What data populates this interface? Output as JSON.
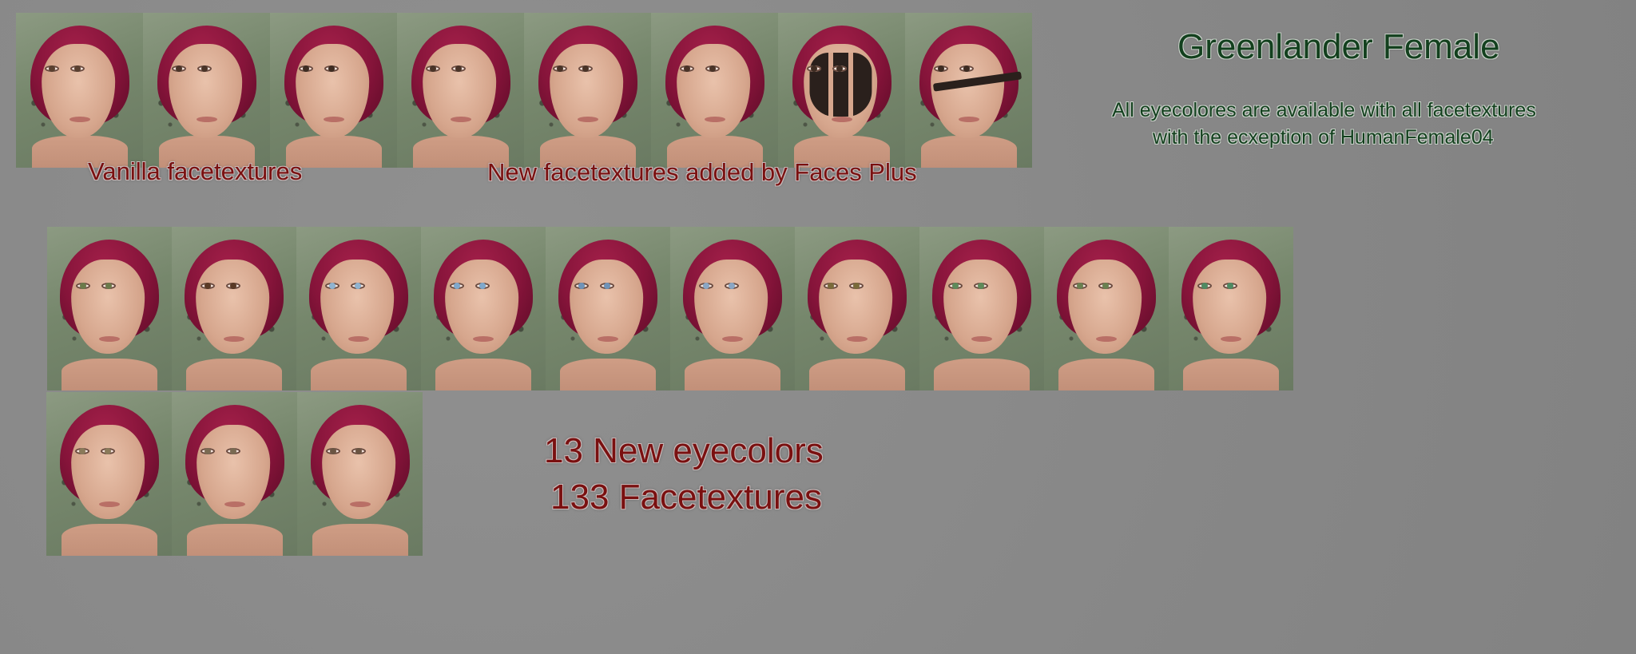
{
  "header": {
    "title": "Greenlander Female",
    "note_line1": "All eyecolores are available with all facetextures",
    "note_line2": "with the ecxeption of HumanFemale04"
  },
  "labels": {
    "vanilla": "Vanilla facetextures",
    "new_faces": "New facetextures added by Faces Plus",
    "count_eyes": "13 New eyecolors",
    "count_textures": "133 Facetextures"
  },
  "colors": {
    "text_red": "#7a1010",
    "text_green": "#13401e",
    "hair": "#86143a",
    "background": "#8a8a8a"
  },
  "facetexture_row": [
    {
      "name": "vanilla-1",
      "iris": "#5a4030",
      "paint": "none"
    },
    {
      "name": "vanilla-2",
      "iris": "#4a3428",
      "paint": "none"
    },
    {
      "name": "vanilla-3",
      "iris": "#3e2c22",
      "paint": "none"
    },
    {
      "name": "vanilla-4",
      "iris": "#4a3428",
      "paint": "none"
    },
    {
      "name": "new-1",
      "iris": "#4a3428",
      "paint": "none"
    },
    {
      "name": "new-2",
      "iris": "#4a3428",
      "paint": "none"
    },
    {
      "name": "new-3",
      "iris": "#3e2c22",
      "paint": "full"
    },
    {
      "name": "new-4",
      "iris": "#3e2c22",
      "paint": "stripe"
    }
  ],
  "eyecolor_row1": [
    {
      "iris": "#6b7a4a"
    },
    {
      "iris": "#5a3a26"
    },
    {
      "iris": "#8fb3d0"
    },
    {
      "iris": "#7fa8cc"
    },
    {
      "iris": "#6f93b8"
    },
    {
      "iris": "#8aa6c4"
    },
    {
      "iris": "#7a6a3a"
    },
    {
      "iris": "#5f8a5a"
    },
    {
      "iris": "#6a8050"
    },
    {
      "iris": "#4f8a62"
    }
  ],
  "eyecolor_row2": [
    {
      "iris": "#8a7a5a"
    },
    {
      "iris": "#7a6a52"
    },
    {
      "iris": "#6a5442"
    }
  ]
}
